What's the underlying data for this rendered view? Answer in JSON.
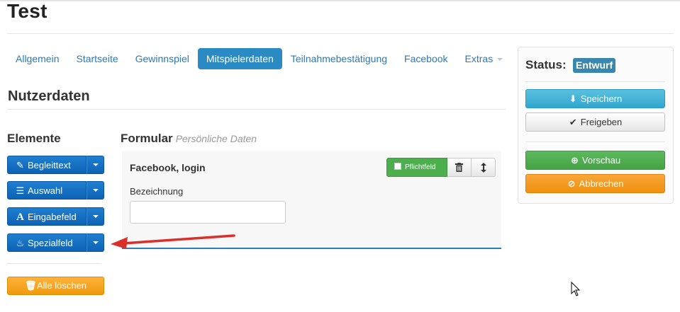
{
  "page": {
    "title": "Test"
  },
  "tabs": [
    {
      "label": "Allgemein"
    },
    {
      "label": "Startseite"
    },
    {
      "label": "Gewinnspiel"
    },
    {
      "label": "Mitspielerdaten",
      "active": true
    },
    {
      "label": "Teilnahmebestätigung"
    },
    {
      "label": "Facebook"
    },
    {
      "label": "Extras",
      "dropdown": true
    }
  ],
  "section": {
    "title": "Nutzerdaten"
  },
  "elements": {
    "title": "Elemente",
    "buttons": [
      {
        "label": "Begleittext",
        "icon": "pencil-icon",
        "glyph": "✎"
      },
      {
        "label": "Auswahl",
        "icon": "list-icon",
        "glyph": "☰"
      },
      {
        "label": "Eingabefeld",
        "icon": "font-icon",
        "glyph": "A"
      },
      {
        "label": "Spezialfeld",
        "icon": "fire-icon",
        "glyph": "♨"
      }
    ],
    "delete_all": {
      "label": "Alle löschen",
      "icon": "trash-icon",
      "glyph": "🗑"
    }
  },
  "form": {
    "title": "Formular",
    "subtitle": "Persönliche Daten",
    "field": {
      "title": "Facebook, login",
      "required_label": "Pflichtfeld",
      "label": "Bezeichnung",
      "value": ""
    }
  },
  "status": {
    "label": "Status:",
    "badge": "Entwurf",
    "badge_color": "#3a87ad",
    "buttons": {
      "save": "Speichern",
      "release": "Freigeben",
      "preview": "Vorschau",
      "cancel": "Abbrechen"
    }
  },
  "colors": {
    "primary": "#2a8ac4",
    "element_button": "#1270c2",
    "success": "#4cae4c",
    "warning": "#f0900c",
    "info": "#5bc0de",
    "annotation_arrow": "#d9302c"
  }
}
